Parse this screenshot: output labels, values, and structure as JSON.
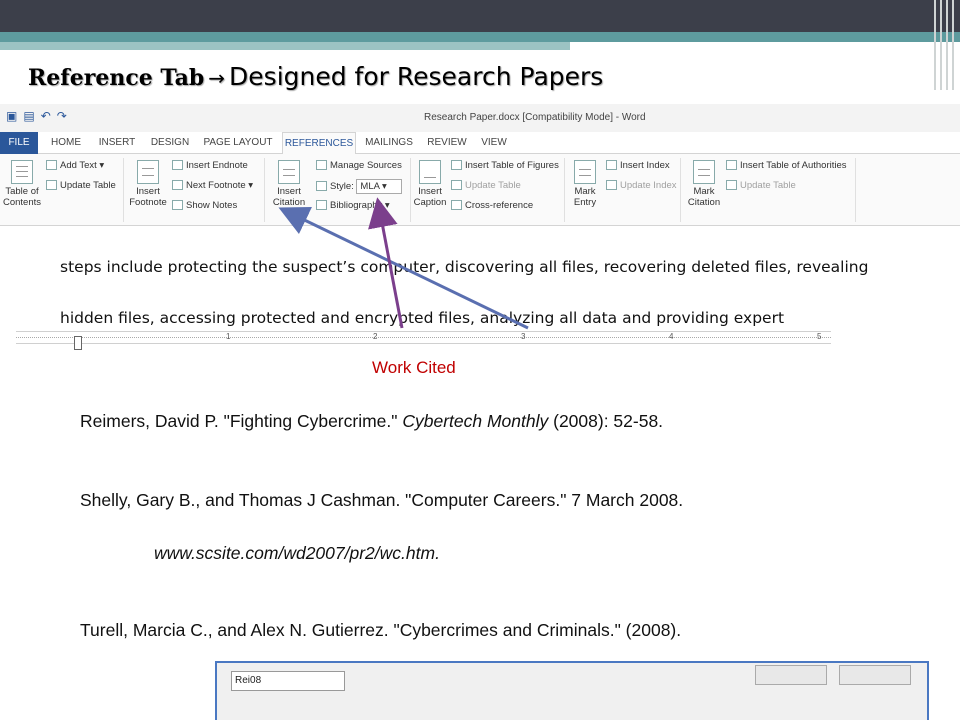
{
  "slide": {
    "title_bold": "Reference Tab",
    "title_arrow": "→",
    "title_rest": "Designed for Research Papers"
  },
  "word": {
    "window_title": "Research Paper.docx [Compatibility Mode] - Word",
    "tabs": [
      "FILE",
      "HOME",
      "INSERT",
      "DESIGN",
      "PAGE LAYOUT",
      "REFERENCES",
      "MAILINGS",
      "REVIEW",
      "VIEW"
    ],
    "active_tab": "REFERENCES",
    "ribbon": {
      "toc_label": "Table of Contents",
      "add_text": "Add Text",
      "update_table": "Update Table",
      "insert_footnote": "Insert Footnote",
      "insert_endnote": "Insert Endnote",
      "next_footnote": "Next Footnote",
      "show_notes": "Show Notes",
      "insert_citation": "Insert Citation",
      "manage_sources": "Manage Sources",
      "style_label": "Style:",
      "style_value": "MLA",
      "bibliography": "Bibliography",
      "insert_caption": "Insert Caption",
      "insert_table_of_figures": "Insert Table of Figures",
      "update_table_captions": "Update Table",
      "cross_reference": "Cross-reference",
      "mark_entry": "Mark Entry",
      "insert_index": "Insert Index",
      "update_index": "Update Index",
      "mark_citation": "Mark Citation",
      "insert_table_of_authorities": "Insert Table of Authorities",
      "update_table_authorities": "Update Table"
    }
  },
  "document": {
    "line1": "steps include protecting the suspect’s computer, discovering all files, recovering deleted files, revealing",
    "line2": "hidden files, accessing protected and encrypted files, analyzing all data and providing expert",
    "ruler_numbers": [
      "1",
      "2",
      "3",
      "4",
      "5"
    ]
  },
  "works_cited": {
    "heading": "Work Cited",
    "entry1_a": "Reimers, David P. \"Fighting Cybercrime.\" ",
    "entry1_b": "Cybertech Monthly",
    "entry1_c": " (2008): 52-58.",
    "entry2": "Shelly, Gary B., and Thomas J Cashman. \"Computer Careers.\" 7 March 2008.",
    "entry2_url": "www.scsite.com/wd2007/pr2/wc.htm.",
    "entry3": "Turell, Marcia C., and Alex N. Gutierrez. \"Cybercrimes and Criminals.\" (2008)."
  },
  "dialog": {
    "tag_value": "Rei08"
  },
  "colors": {
    "accent_arrow": "#7b3f8c",
    "blue_arrow": "#5a6fb0",
    "heading_red": "#c00000",
    "word_blue": "#2b579a"
  }
}
